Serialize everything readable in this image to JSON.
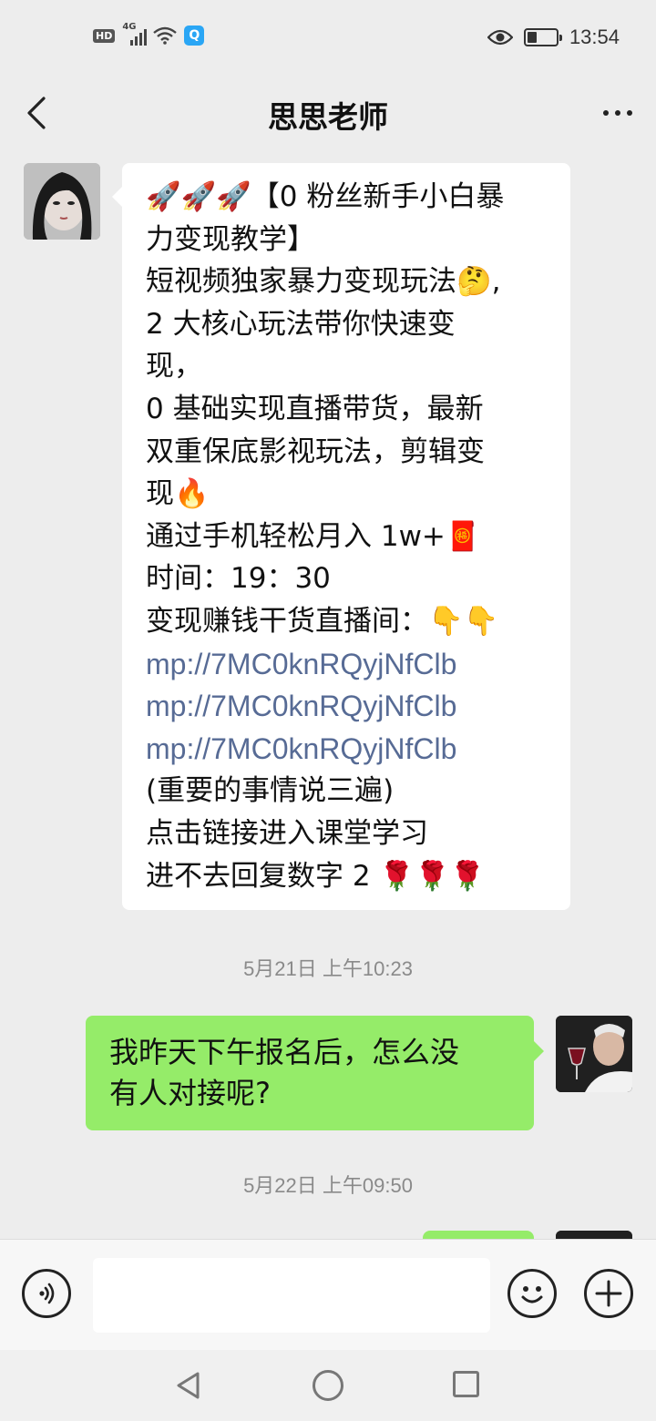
{
  "status_bar": {
    "hd_label": "HD",
    "network_label": "4G",
    "search_badge": "Q",
    "time": "13:54",
    "battery_level": 0.35
  },
  "header": {
    "title": "思思老师",
    "back_icon": "chevron-left-icon",
    "more_icon": "more-dots-icon"
  },
  "messages": [
    {
      "direction": "incoming",
      "lines": [
        "🚀🚀🚀【0 粉丝新手小白暴",
        "力变现教学】",
        "短视频独家暴力变现玩法🤔,",
        "2 大核心玩法带你快速变",
        "现，",
        "0 基础实现直播带货，最新",
        "双重保底影视玩法，剪辑变",
        "现🔥",
        "通过手机轻松月入 1w+🧧",
        "时间：19：30",
        "变现赚钱干货直播间：👇👇"
      ],
      "links": [
        "mp://7MC0knRQyjNfClb",
        "mp://7MC0knRQyjNfClb",
        "mp://7MC0knRQyjNfClb"
      ],
      "after_lines": [
        "(重要的事情说三遍)",
        "点击链接进入课堂学习",
        "进不去回复数字 2 🌹🌹🌹"
      ]
    },
    {
      "direction": "outgoing",
      "lines": [
        "我昨天下午报名后，怎么没",
        "有人对接呢?"
      ]
    }
  ],
  "timestamps": [
    "5月21日 上午10:23",
    "5月22日 上午09:50"
  ],
  "input_bar": {
    "voice_icon": "voice-icon",
    "emoji_icon": "emoji-icon",
    "plus_icon": "plus-icon",
    "placeholder": ""
  },
  "nav_bar": {
    "back_icon": "triangle-back-icon",
    "home_icon": "circle-home-icon",
    "recent_icon": "square-recent-icon"
  },
  "colors": {
    "background": "#ededed",
    "outgoing_bubble": "#95ec69",
    "incoming_bubble": "#ffffff",
    "link": "#576b95"
  }
}
